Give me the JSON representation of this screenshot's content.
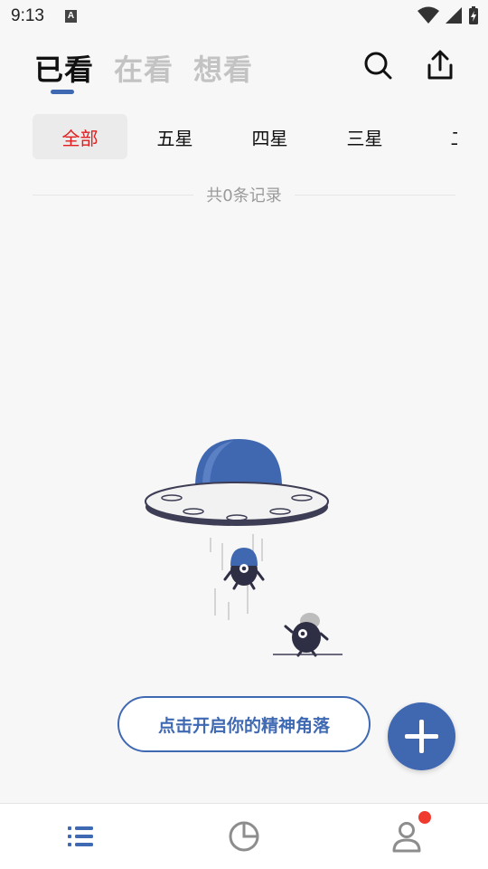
{
  "status_bar": {
    "time": "9:13",
    "notification_letter": "A"
  },
  "header": {
    "tabs": [
      {
        "label": "已看",
        "active": true
      },
      {
        "label": "在看",
        "active": false
      },
      {
        "label": "想看",
        "active": false
      }
    ],
    "search_icon": "search-icon",
    "share_icon": "share-icon"
  },
  "filters": [
    {
      "label": "全部",
      "active": true
    },
    {
      "label": "五星",
      "active": false
    },
    {
      "label": "四星",
      "active": false
    },
    {
      "label": "三星",
      "active": false
    },
    {
      "label": "二",
      "active": false
    }
  ],
  "record_count": "共0条记录",
  "empty_state": {
    "cta_label": "点击开启你的精神角落"
  },
  "fab_icon": "plus-icon",
  "bottom_nav": [
    {
      "icon": "list-icon",
      "active": true
    },
    {
      "icon": "pie-chart-icon",
      "active": false
    },
    {
      "icon": "profile-icon",
      "active": false,
      "badge": true
    }
  ],
  "colors": {
    "accent": "#3f69b3",
    "active_filter": "#e11d1d",
    "badge": "#f03a2e"
  }
}
